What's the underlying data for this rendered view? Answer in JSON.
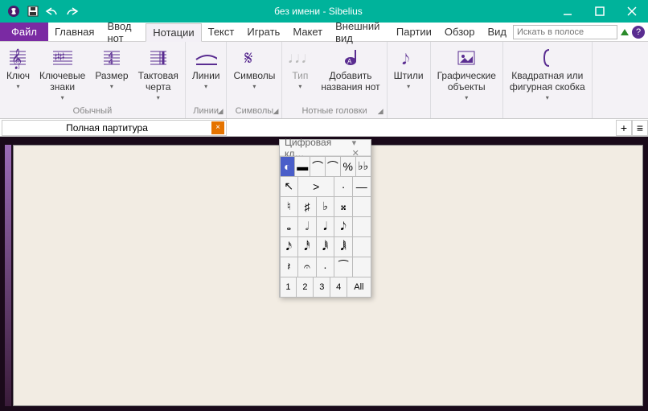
{
  "window": {
    "title": "без имени - Sibelius"
  },
  "qat": {
    "save": "save",
    "undo": "undo",
    "redo": "redo"
  },
  "wincontrols": {
    "min": "min",
    "max": "max",
    "close": "close"
  },
  "tabs": {
    "file": "Файл",
    "list": [
      "Главная",
      "Ввод нот",
      "Нотации",
      "Текст",
      "Играть",
      "Макет",
      "Внешний вид",
      "Партии",
      "Обзор",
      "Вид"
    ],
    "active_index": 2,
    "search_placeholder": "Искать в полосе"
  },
  "ribbon": {
    "groups": [
      {
        "label": "Обычный",
        "items": [
          {
            "label": "Ключ",
            "dropdown": true
          },
          {
            "label": "Ключевые\nзнаки",
            "dropdown": true
          },
          {
            "label": "Размер",
            "dropdown": true
          },
          {
            "label": "Тактовая\nчерта",
            "dropdown": true
          }
        ]
      },
      {
        "label": "Линии",
        "launcher": true,
        "items": [
          {
            "label": "Линии",
            "dropdown": true
          }
        ]
      },
      {
        "label": "Символы",
        "launcher": true,
        "items": [
          {
            "label": "Символы",
            "dropdown": true
          }
        ]
      },
      {
        "label": "Нотные головки",
        "launcher": true,
        "items": [
          {
            "label": "Тип",
            "dropdown": true,
            "gray": true
          },
          {
            "label": "Добавить\nназвания нот"
          }
        ]
      },
      {
        "label": "",
        "items": [
          {
            "label": "Штили",
            "dropdown": true
          }
        ]
      },
      {
        "label": "",
        "items": [
          {
            "label": "Графические\nобъекты",
            "dropdown": true
          }
        ]
      },
      {
        "label": "",
        "items": [
          {
            "label": "Квадратная или\nфигурная скобка",
            "dropdown": true
          }
        ]
      }
    ]
  },
  "doctab": {
    "label": "Полная партитура",
    "close": "×",
    "add": "+",
    "menu": "≡"
  },
  "keypad": {
    "title": "Цифровая кл…",
    "tabs": [
      "◐",
      "▬",
      "⌒",
      "⌒",
      "%",
      "♭♭"
    ],
    "active_tab": 0,
    "rows": [
      [
        "↖",
        ">",
        "·",
        "",
        "—"
      ],
      [
        "♮",
        "♯",
        "♭",
        "𝄪",
        ""
      ],
      [
        "𝅝",
        "𝅗𝅥",
        "𝅘𝅥",
        "𝅘𝅥𝅮",
        ""
      ],
      [
        "𝅘𝅥𝅯",
        "𝅘𝅥𝅰",
        "𝅘𝅥𝅱",
        "𝅘𝅥𝅲",
        ""
      ],
      [
        "𝄽",
        "𝄐",
        "·",
        "⁀",
        ""
      ]
    ],
    "footer": [
      "1",
      "2",
      "3",
      "4",
      "All"
    ]
  }
}
